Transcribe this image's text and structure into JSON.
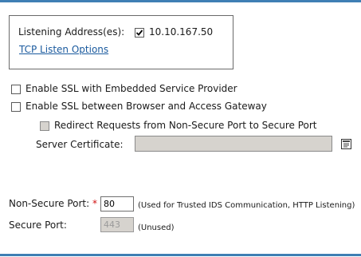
{
  "listening": {
    "label": "Listening Address(es):",
    "address": "10.10.167.50",
    "address_checked": true,
    "tcp_link": "TCP Listen Options"
  },
  "ssl": {
    "embedded_label": "Enable SSL with Embedded Service Provider",
    "embedded_checked": false,
    "browser_label": "Enable SSL between Browser and Access Gateway",
    "browser_checked": false,
    "redirect_label": "Redirect Requests from Non-Secure Port to Secure Port",
    "redirect_checked": false,
    "redirect_disabled": true
  },
  "certificate": {
    "label": "Server Certificate:",
    "value": "",
    "browse_icon": "browse-list-icon"
  },
  "ports": {
    "non_secure_label": "Non-Secure Port:",
    "required_marker": "*",
    "non_secure_value": "80",
    "non_secure_note": "(Used for Trusted IDS Communication, HTTP Listening)",
    "secure_label": "Secure Port:",
    "secure_value": "443",
    "secure_note": "(Unused)"
  },
  "colors": {
    "accent_rule": "#3f7fb4",
    "link": "#1a5a9e",
    "required": "#d01010",
    "disabled_fill": "#d6d3ce"
  }
}
